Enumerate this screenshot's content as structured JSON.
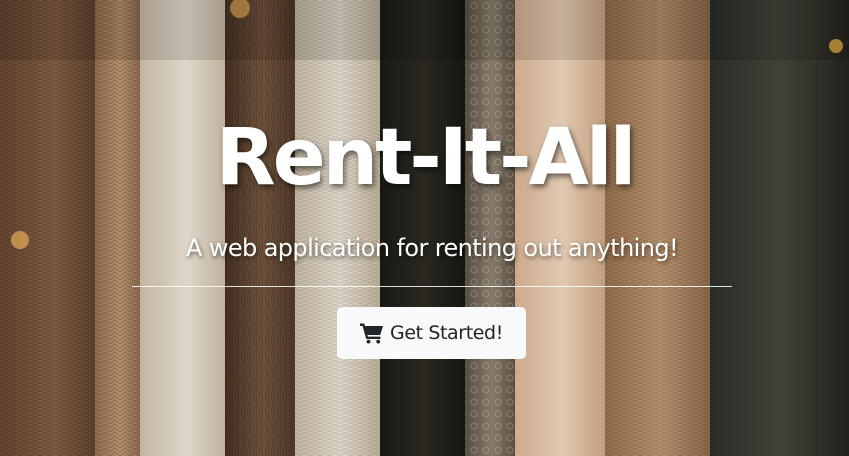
{
  "hero": {
    "title": "Rent-It-All",
    "subtitle": "A web application for renting out anything!",
    "background_icon": "hanging-clothes-rack-photo",
    "cta": {
      "label": "Get Started!",
      "icon": "shopping-cart-icon"
    }
  },
  "colors": {
    "title_text": "#ffffff",
    "button_bg": "#f8f9fa",
    "button_text": "#212529",
    "divider": "#ffffff"
  }
}
